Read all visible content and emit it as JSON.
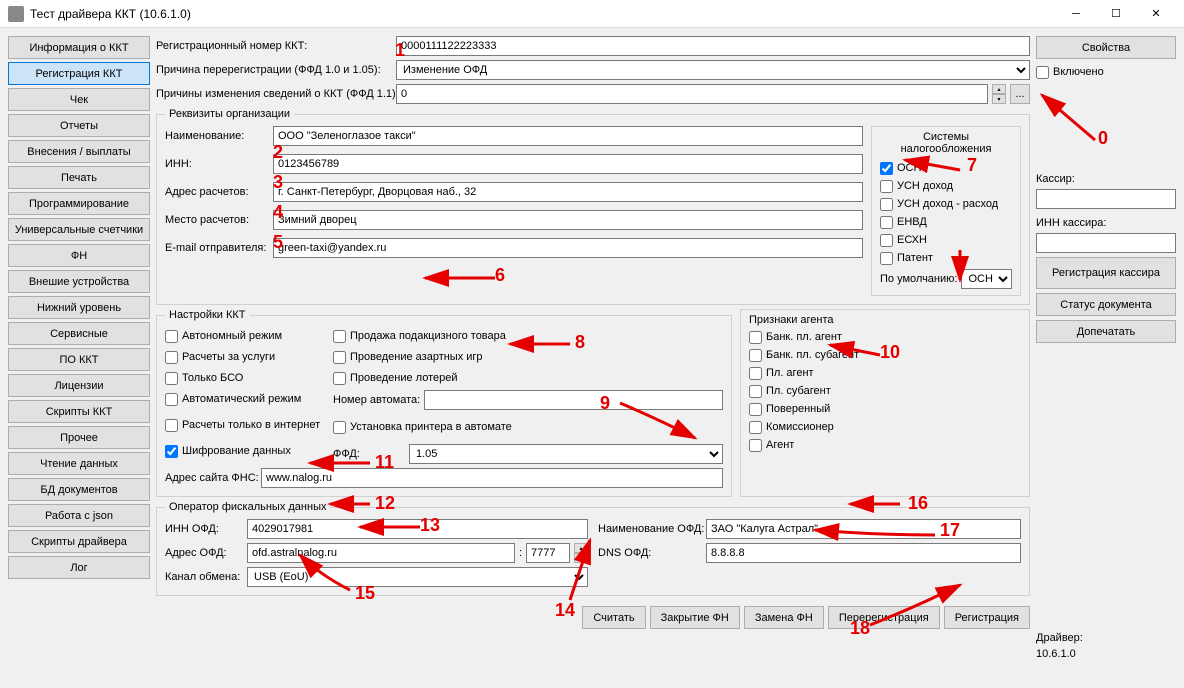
{
  "title": "Тест драйвера ККТ (10.6.1.0)",
  "sidebar": {
    "items": [
      "Информация о ККТ",
      "Регистрация ККТ",
      "Чек",
      "Отчеты",
      "Внесения / выплаты",
      "Печать",
      "Программирование",
      "Универсальные счетчики",
      "ФН",
      "Внешие устройства",
      "Нижний уровень",
      "Сервисные",
      "ПО ККТ",
      "Лицензии",
      "Скрипты ККТ",
      "Прочее",
      "Чтение данных",
      "БД документов",
      "Работа с json",
      "Скрипты драйвера",
      "Лог"
    ],
    "active_index": 1
  },
  "top": {
    "reg_num_label": "Регистрационный номер ККТ:",
    "reg_num_value": "0000111122223333",
    "rereg_reason_label": "Причина перерегистрации (ФФД 1.0 и 1.05):",
    "rereg_reason_value": "Изменение ОФД",
    "changes_reasons_label": "Причины изменения сведений о ККТ (ФФД 1.1):",
    "changes_reasons_value": "0"
  },
  "org": {
    "legend": "Реквизиты организации",
    "name_label": "Наименование:",
    "name_value": "ООО \"Зеленоглазое такси\"",
    "inn_label": "ИНН:",
    "inn_value": "0123456789",
    "addr_label": "Адрес расчетов:",
    "addr_value": "г. Санкт-Петербург, Дворцовая наб., 32",
    "place_label": "Место расчетов:",
    "place_value": "Зимний дворец",
    "email_label": "E-mail отправителя:",
    "email_value": "green-taxi@yandex.ru",
    "tax": {
      "title": "Системы налогообложения",
      "osn": "ОСН",
      "usn_d": "УСН доход",
      "usn_dr": "УСН доход - расход",
      "envd": "ЕНВД",
      "eshn": "ЕСХН",
      "patent": "Патент",
      "default_label": "По умолчанию:",
      "default_value": "ОСН"
    }
  },
  "kkt": {
    "legend": "Настройки ККТ",
    "autonomous": "Автономный режим",
    "services": "Расчеты за услуги",
    "bso_only": "Только БСО",
    "auto_mode": "Автоматический режим",
    "internet_only": "Расчеты только в интернет",
    "encryption": "Шифрование данных",
    "excise": "Продажа подакцизного товара",
    "gambling": "Проведение азартных игр",
    "lottery": "Проведение лотерей",
    "machine_num_label": "Номер автомата:",
    "machine_num_value": "",
    "printer_in_machine": "Установка принтера в автомате",
    "ffd_label": "ФФД:",
    "ffd_value": "1.05",
    "fns_label": "Адрес сайта ФНС:",
    "fns_value": "www.nalog.ru"
  },
  "agent": {
    "legend": "Признаки агента",
    "bank_agent": "Банк. пл. агент",
    "bank_subagent": "Банк. пл. субагент",
    "pay_agent": "Пл. агент",
    "pay_subagent": "Пл. субагент",
    "attorney": "Поверенный",
    "commissioner": "Комиссионер",
    "agent": "Агент"
  },
  "ofd": {
    "legend": "Оператор фискальных данных",
    "inn_label": "ИНН ОФД:",
    "inn_value": "4029017981",
    "addr_label": "Адрес ОФД:",
    "addr_value": "ofd.astralnalog.ru",
    "port_value": "7777",
    "name_label": "Наименование ОФД:",
    "name_value": "ЗАО \"Калуга Астрал\"",
    "dns_label": "DNS ОФД:",
    "dns_value": "8.8.8.8",
    "channel_label": "Канал обмена:",
    "channel_value": "USB (EoU)"
  },
  "buttons": {
    "read": "Считать",
    "close_fn": "Закрытие ФН",
    "change_fn": "Замена ФН",
    "rereg": "Перерегистрация",
    "reg": "Регистрация"
  },
  "right": {
    "properties": "Свойства",
    "enabled": "Включено",
    "cashier_label": "Кассир:",
    "cashier_value": "",
    "cashier_inn_label": "ИНН кассира:",
    "cashier_inn_value": "",
    "reg_cashier": "Регистрация кассира",
    "doc_status": "Статус документа",
    "print_more": "Допечатать",
    "driver_label": "Драйвер:",
    "driver_version": "10.6.1.0"
  },
  "annotations": [
    "0",
    "1",
    "2",
    "3",
    "4",
    "5",
    "6",
    "7",
    "8",
    "9",
    "10",
    "11",
    "12",
    "13",
    "14",
    "15",
    "16",
    "17",
    "18"
  ]
}
